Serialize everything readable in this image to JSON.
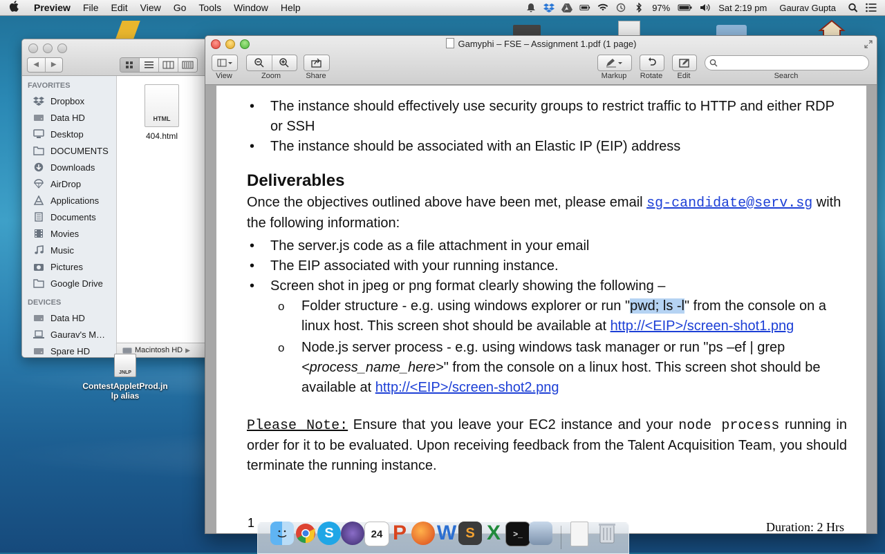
{
  "menubar": {
    "app_name": "Preview",
    "items": [
      "File",
      "Edit",
      "View",
      "Go",
      "Tools",
      "Window",
      "Help"
    ],
    "battery": "97%",
    "clock": "Sat 2:19 pm",
    "user": "Gaurav Gupta"
  },
  "finder": {
    "sidebar_favorites_heading": "FAVORITES",
    "favorites": [
      "Dropbox",
      "Data HD",
      "Desktop",
      "DOCUMENTS",
      "Downloads",
      "AirDrop",
      "Applications",
      "Documents",
      "Movies",
      "Music",
      "Pictures",
      "Google Drive"
    ],
    "sidebar_devices_heading": "DEVICES",
    "devices": [
      "Data HD",
      "Gaurav's M…",
      "Spare HD"
    ],
    "file_name": "404.html",
    "file_type_label": "HTML",
    "path": "Macintosh HD"
  },
  "desktop": {
    "alias_name_line1": "ContestAppletProd.jn",
    "alias_name_line2": "lp alias",
    "alias_badge": "JNLP"
  },
  "preview": {
    "window_title": "Gamyphi – FSE – Assignment 1.pdf (1 page)",
    "toolbar": {
      "view_label": "View",
      "zoom_label": "Zoom",
      "share_label": "Share",
      "markup_label": "Markup",
      "rotate_label": "Rotate",
      "edit_label": "Edit",
      "search_label": "Search"
    },
    "document": {
      "bullet1": "The instance should effectively use security groups to restrict traffic to HTTP and either RDP or SSH",
      "bullet2": "The instance should be associated with an Elastic IP (EIP) address",
      "heading": "Deliverables",
      "intro_before": "Once the objectives outlined above have been met, please email ",
      "email": "sg-candidate@serv.sg",
      "intro_after": " with the following information:",
      "bullet3": "The server.js code as a file attachment in your email",
      "bullet4": "The EIP associated with your running instance.",
      "bullet5": "Screen shot in jpeg or png format clearly showing the following –",
      "sub1_before": "Folder structure - e.g. using windows explorer or run \"",
      "sub1_highlight": "pwd; ls -l",
      "sub1_after": "\" from the console on a linux host. This screen shot should be available at ",
      "sub1_link": "http://<EIP>/screen-shot1.png",
      "sub2_before": " Node.js server process - e.g. using windows task manager or run \"ps –ef | grep ",
      "sub2_italic": "<process_name_here>",
      "sub2_after": "\" from the console on a linux host. This screen shot should be available at ",
      "sub2_link": "http://<EIP>/screen-shot2.png",
      "note_label": "Please Note:",
      "note_before": " Ensure that you leave your EC2 instance and your ",
      "note_mono": "node process",
      "note_after": " running in order for it to be evaluated. Upon receiving feedback from the Talent Acquisition Team, you should terminate the running instance.",
      "page_number": "1",
      "duration": "Duration: 2 Hrs"
    }
  },
  "dock": {
    "apps": [
      "Finder",
      "Chrome",
      "Skype",
      "Eclipse",
      "Calendar",
      "PowerPoint",
      "Firefox",
      "Word",
      "Sublime Text",
      "Excel",
      "Terminal",
      "Preview",
      "Documents",
      "Trash"
    ],
    "calendar_day": "24"
  }
}
